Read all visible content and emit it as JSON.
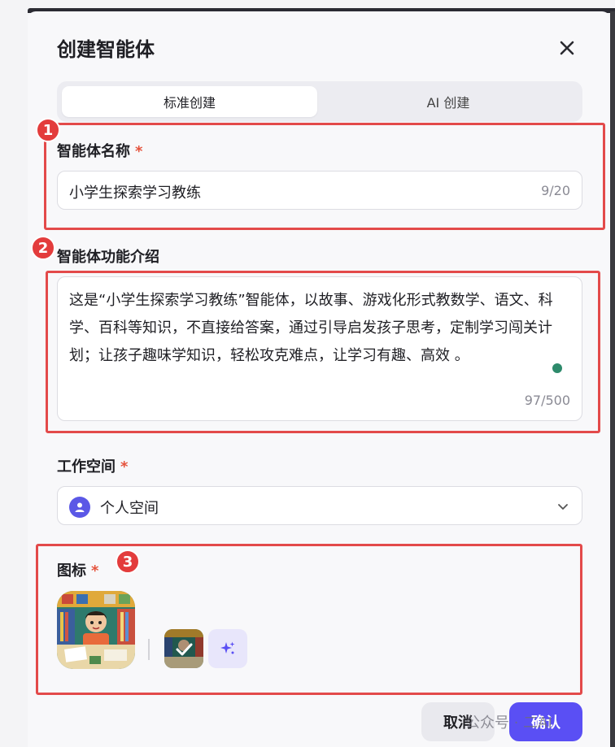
{
  "dialog": {
    "title": "创建智能体",
    "close_icon": "close-icon"
  },
  "tabs": [
    {
      "label": "标准创建",
      "active": true
    },
    {
      "label": "AI 创建",
      "active": false
    }
  ],
  "annotations": [
    "1",
    "2",
    "3"
  ],
  "name_field": {
    "label": "智能体名称",
    "required_mark": "*",
    "value": "小学生探索学习教练",
    "counter": "9/20"
  },
  "description_field": {
    "label": "智能体功能介绍",
    "value": "这是“小学生探索学习教练”智能体，以故事、游戏化形式教数学、语文、科学、百科等知识，不直接给答案，通过引导启发孩子思考，定制学习闯关计划；让孩子趣味学知识，轻松攻克难点，让学习有趣、高效 。",
    "counter": "97/500"
  },
  "workspace_field": {
    "label": "工作空间",
    "required_mark": "*",
    "value": "个人空间",
    "icon": "user-avatar-icon"
  },
  "icon_field": {
    "label": "图标",
    "required_mark": "*",
    "generate_icon": "sparkle-icon"
  },
  "footer": {
    "cancel_label": "取消",
    "confirm_label": "确认",
    "watermark": "公众号 · 二AI"
  },
  "colors": {
    "accent": "#5a4ff4",
    "required": "#e5533d",
    "annotation": "#e34a4a"
  }
}
